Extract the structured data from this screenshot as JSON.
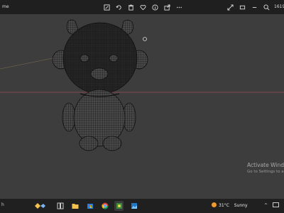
{
  "titlebar": {
    "app_title": "me",
    "zoom_readout": "1619",
    "toolbar_icons": [
      "edit-icon",
      "rotate-icon",
      "delete-icon",
      "favorite-icon",
      "info-icon",
      "share-icon",
      "more-icon"
    ],
    "right_icons": [
      "expand-icon",
      "fit-icon",
      "zoom-out-icon",
      "zoom-in-icon"
    ]
  },
  "viewport": {
    "model": "wireframe bear mesh",
    "mesh_color": "#111111",
    "horizon_color": "#a14a52",
    "background_color": "#3d3d3d"
  },
  "watermark": {
    "line1": "Activate Windo",
    "line2": "Go to Settings to activ"
  },
  "taskbar": {
    "search_label": "h",
    "apps": [
      "copilot-icon",
      "task-view-icon",
      "file-explorer-icon",
      "store-icon",
      "chrome-icon",
      "game-icon",
      "photos-icon"
    ],
    "weather_temp": "31°C",
    "weather_text": "Sunny",
    "tray_arrow": "^"
  }
}
